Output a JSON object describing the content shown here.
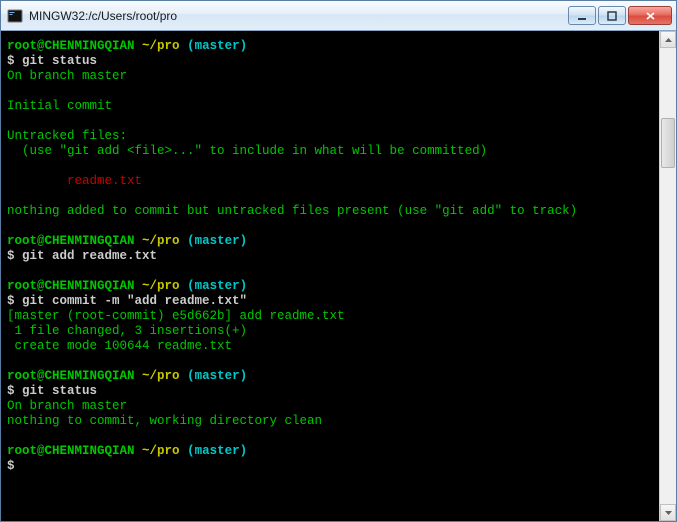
{
  "window": {
    "title": "MINGW32:/c/Users/root/pro"
  },
  "prompt": {
    "user_host": "root@CHENMINGQIAN",
    "path": "~/pro",
    "branch": "(master)"
  },
  "blocks": [
    {
      "cmd": "git status",
      "out": [
        {
          "text": "On branch master",
          "cls": "c-green"
        },
        {
          "text": "",
          "cls": ""
        },
        {
          "text": "Initial commit",
          "cls": "c-green"
        },
        {
          "text": "",
          "cls": ""
        },
        {
          "text": "Untracked files:",
          "cls": "c-green"
        },
        {
          "text": "  (use \"git add <file>...\" to include in what will be committed)",
          "cls": "c-green"
        },
        {
          "text": "",
          "cls": ""
        },
        {
          "text": "        readme.txt",
          "cls": "c-red"
        },
        {
          "text": "",
          "cls": ""
        },
        {
          "text": "nothing added to commit but untracked files present (use \"git add\" to track)",
          "cls": "c-green"
        },
        {
          "text": "",
          "cls": ""
        }
      ]
    },
    {
      "cmd": "git add readme.txt",
      "out": [
        {
          "text": "",
          "cls": ""
        }
      ]
    },
    {
      "cmd": "git commit -m \"add readme.txt\"",
      "out": [
        {
          "text": "[master (root-commit) e5d662b] add readme.txt",
          "cls": "c-green"
        },
        {
          "text": " 1 file changed, 3 insertions(+)",
          "cls": "c-green"
        },
        {
          "text": " create mode 100644 readme.txt",
          "cls": "c-green"
        },
        {
          "text": "",
          "cls": ""
        }
      ]
    },
    {
      "cmd": "git status",
      "out": [
        {
          "text": "On branch master",
          "cls": "c-green"
        },
        {
          "text": "nothing to commit, working directory clean",
          "cls": "c-green"
        },
        {
          "text": "",
          "cls": ""
        }
      ]
    },
    {
      "cmd": "",
      "out": []
    }
  ],
  "dollar": "$ "
}
